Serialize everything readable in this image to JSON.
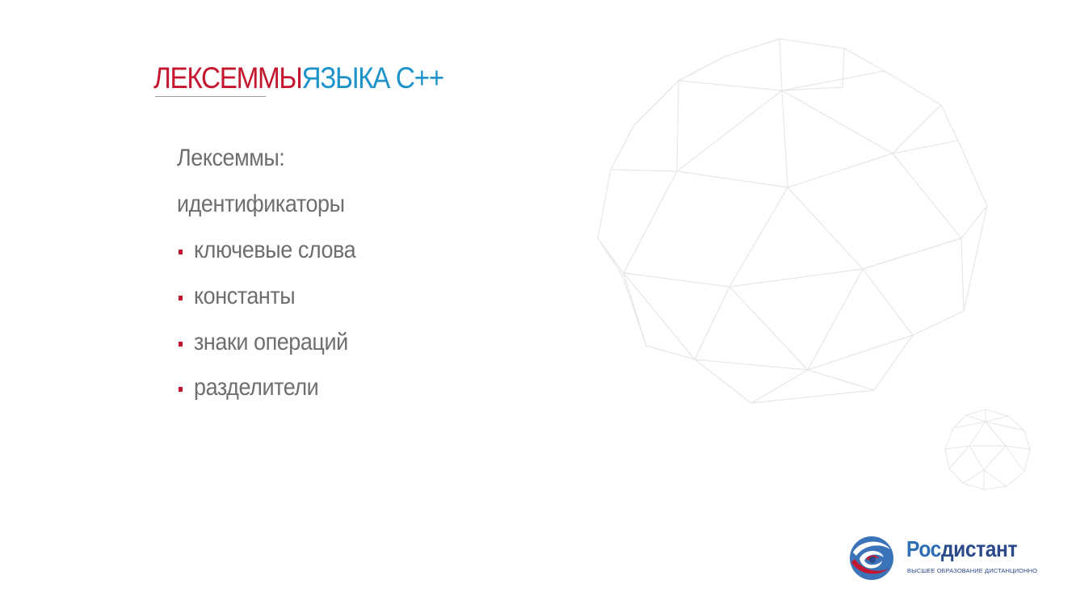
{
  "slide": {
    "title_part1": "ЛЕКСЕММЫ",
    "title_part2": "ЯЗЫКА С++",
    "lines": [
      "Лексеммы:",
      "идентификаторы"
    ],
    "bullets": [
      "ключевые слова",
      "константы",
      "знаки операций",
      "разделители"
    ]
  },
  "logo": {
    "name_part1": "Рос",
    "name_part2": "дистант",
    "tagline": "ВЫСШЕЕ ОБРАЗОВАНИЕ ДИСТАНЦИОННО",
    "icon": "rosdistant-globe-icon"
  },
  "colors": {
    "accent_red": "#c4162f",
    "accent_blue": "#1d93c9",
    "text_gray": "#6e6e6e",
    "brand_blue": "#2f6db5",
    "brand_dark": "#2b4a8a"
  }
}
